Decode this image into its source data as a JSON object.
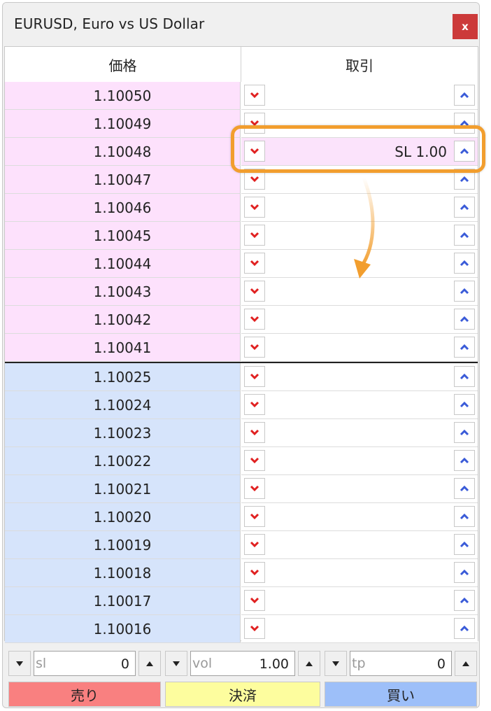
{
  "window": {
    "title": "EURUSD, Euro vs US Dollar",
    "close_label": "x"
  },
  "table": {
    "headers": {
      "price": "価格",
      "trade": "取引"
    },
    "ask_rows": [
      "1.10050",
      "1.10049",
      "1.10048",
      "1.10047",
      "1.10046",
      "1.10045",
      "1.10044",
      "1.10043",
      "1.10042",
      "1.10041"
    ],
    "bid_rows": [
      "1.10025",
      "1.10024",
      "1.10023",
      "1.10022",
      "1.10021",
      "1.10020",
      "1.10019",
      "1.10018",
      "1.10017",
      "1.10016"
    ],
    "pending_order": {
      "row_price": "1.10048",
      "label": "SL 1.00"
    }
  },
  "controls": {
    "sl": {
      "label": "sl",
      "value": "0"
    },
    "vol": {
      "label": "vol",
      "value": "1.00"
    },
    "tp": {
      "label": "tp",
      "value": "0"
    }
  },
  "buttons": {
    "sell": "売り",
    "close": "決済",
    "buy": "買い"
  },
  "colors": {
    "ask_row": "#fde1fc",
    "bid_row": "#d6e4fb",
    "sell_arrow": "#e02020",
    "buy_arrow": "#3a5bd8",
    "highlight": "#f29e2e",
    "sell_button": "#f98080",
    "close_button": "#fdfd9e",
    "buy_button": "#9dbff9"
  }
}
